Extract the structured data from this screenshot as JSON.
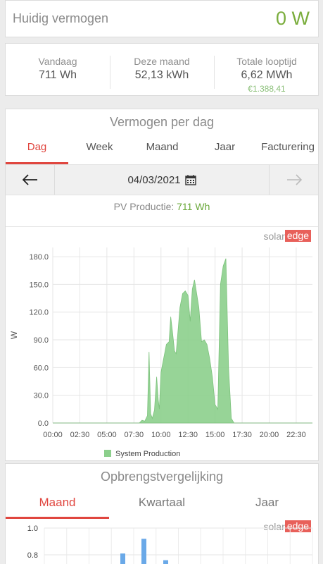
{
  "current_power": {
    "label": "Huidig vermogen",
    "value": "0 W"
  },
  "stats": [
    {
      "title": "Vandaag",
      "value": "711 Wh",
      "money": ""
    },
    {
      "title": "Deze maand",
      "value": "52,13 kWh",
      "money": ""
    },
    {
      "title": "Totale looptijd",
      "value": "6,62 MWh",
      "money": "€1.388,41"
    }
  ],
  "power_chart": {
    "title": "Vermogen per dag",
    "tabs": [
      "Dag",
      "Week",
      "Maand",
      "Jaar",
      "Facturering"
    ],
    "active_tab": "Dag",
    "date": "04/03/2021",
    "pv_label": "PV Productie:",
    "pv_value": "711 Wh",
    "logo": {
      "solar": "solar",
      "edge": "edge"
    }
  },
  "chart_data": {
    "type": "area",
    "ylabel": "W",
    "xlabel": "",
    "ylim": [
      0,
      190
    ],
    "yticks": [
      "0.0",
      "30.0",
      "60.0",
      "90.0",
      "120.0",
      "150.0",
      "180.0"
    ],
    "xticks": [
      "00:00",
      "02:30",
      "05:00",
      "07:30",
      "10:00",
      "12:30",
      "15:00",
      "17:30",
      "20:00",
      "22:30"
    ],
    "xlim_hours": [
      0,
      24
    ],
    "grid": true,
    "legend_position": "bottom",
    "series": [
      {
        "name": "System Production",
        "color": "#8ccf8c",
        "points": [
          [
            0,
            0
          ],
          [
            8.0,
            0
          ],
          [
            8.25,
            3
          ],
          [
            8.5,
            2
          ],
          [
            8.75,
            8
          ],
          [
            8.9,
            77
          ],
          [
            9.05,
            10
          ],
          [
            9.2,
            5
          ],
          [
            9.4,
            14
          ],
          [
            9.6,
            50
          ],
          [
            9.75,
            25
          ],
          [
            9.85,
            15
          ],
          [
            10.0,
            55
          ],
          [
            10.25,
            70
          ],
          [
            10.5,
            85
          ],
          [
            10.75,
            88
          ],
          [
            10.9,
            115
          ],
          [
            11.05,
            100
          ],
          [
            11.25,
            78
          ],
          [
            11.4,
            75
          ],
          [
            11.75,
            125
          ],
          [
            12.0,
            140
          ],
          [
            12.25,
            143
          ],
          [
            12.5,
            138
          ],
          [
            12.7,
            110
          ],
          [
            12.9,
            145
          ],
          [
            13.1,
            155
          ],
          [
            13.5,
            125
          ],
          [
            13.75,
            88
          ],
          [
            14.0,
            90
          ],
          [
            14.25,
            85
          ],
          [
            14.5,
            70
          ],
          [
            14.75,
            50
          ],
          [
            15.0,
            20
          ],
          [
            15.25,
            15
          ],
          [
            15.5,
            150
          ],
          [
            15.75,
            170
          ],
          [
            16.0,
            178
          ],
          [
            16.25,
            60
          ],
          [
            16.5,
            5
          ],
          [
            16.75,
            0
          ],
          [
            24,
            0
          ]
        ]
      }
    ]
  },
  "comparison": {
    "title": "Opbrengstvergelijking",
    "tabs": [
      "Maand",
      "Kwartaal",
      "Jaar"
    ],
    "active_tab": "Maand",
    "yticks": [
      "1.0",
      "0.8"
    ],
    "ylim": [
      0.7,
      1.0
    ],
    "bars": [
      0.81,
      0.92,
      0.76
    ],
    "bar_color": "#6aa9e8",
    "logo": {
      "solar": "solar",
      "edge": "edge"
    }
  }
}
